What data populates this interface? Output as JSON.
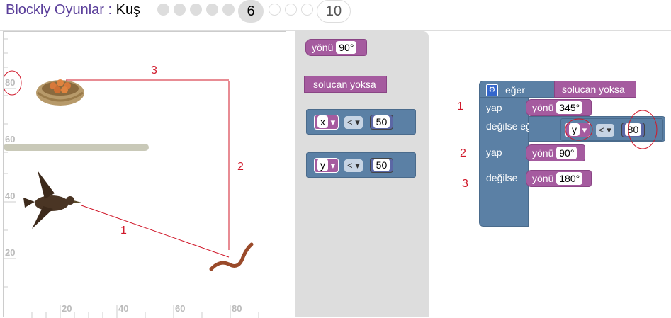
{
  "header": {
    "app_name": "Blockly Oyunlar",
    "separator": " : ",
    "game_name": "Kuş",
    "current_level": "6",
    "last_level": "10"
  },
  "stage": {
    "y_ticks": [
      "80",
      "60",
      "40",
      "20"
    ],
    "x_ticks": [
      "20",
      "40",
      "60",
      "80"
    ],
    "annotations": [
      "3",
      "2",
      "1"
    ]
  },
  "toolbox": {
    "heading_block": {
      "label": "yönü",
      "value": "90°"
    },
    "worm_block": {
      "label": "solucan yoksa"
    },
    "compare_x": {
      "var": "x",
      "op": "<",
      "value": "50"
    },
    "compare_y": {
      "var": "y",
      "op": "<",
      "value": "50"
    }
  },
  "workspace": {
    "if_label": "eğer",
    "condition": "solucan yoksa",
    "do_label": "yap",
    "heading_label": "yönü",
    "heading_1": "345°",
    "elseif_label": "değilse eğer",
    "cond_var": "y",
    "cond_op": "<",
    "cond_value": "80",
    "heading_2": "90°",
    "else_label": "değilse",
    "heading_3": "180°",
    "annotations": [
      "1",
      "2",
      "3"
    ]
  },
  "colors": {
    "purple_block": "#a55b9f",
    "steel_block": "#5b80a5",
    "title_purple": "#5a3e9a",
    "annotation_red": "#d0182a"
  }
}
